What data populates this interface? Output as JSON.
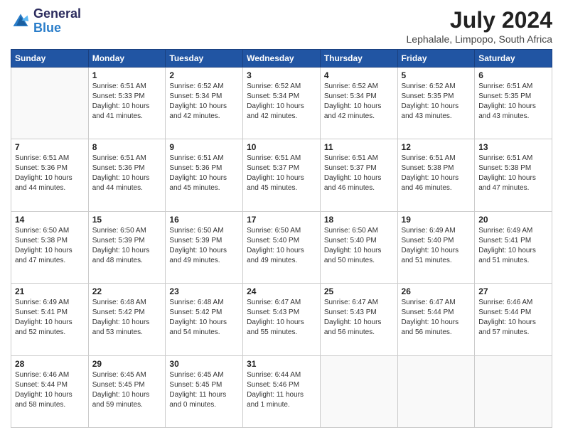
{
  "logo": {
    "line1": "General",
    "line2": "Blue"
  },
  "title": "July 2024",
  "location": "Lephalale, Limpopo, South Africa",
  "days_of_week": [
    "Sunday",
    "Monday",
    "Tuesday",
    "Wednesday",
    "Thursday",
    "Friday",
    "Saturday"
  ],
  "weeks": [
    [
      {
        "day": "",
        "info": ""
      },
      {
        "day": "1",
        "info": "Sunrise: 6:51 AM\nSunset: 5:33 PM\nDaylight: 10 hours\nand 41 minutes."
      },
      {
        "day": "2",
        "info": "Sunrise: 6:52 AM\nSunset: 5:34 PM\nDaylight: 10 hours\nand 42 minutes."
      },
      {
        "day": "3",
        "info": "Sunrise: 6:52 AM\nSunset: 5:34 PM\nDaylight: 10 hours\nand 42 minutes."
      },
      {
        "day": "4",
        "info": "Sunrise: 6:52 AM\nSunset: 5:34 PM\nDaylight: 10 hours\nand 42 minutes."
      },
      {
        "day": "5",
        "info": "Sunrise: 6:52 AM\nSunset: 5:35 PM\nDaylight: 10 hours\nand 43 minutes."
      },
      {
        "day": "6",
        "info": "Sunrise: 6:51 AM\nSunset: 5:35 PM\nDaylight: 10 hours\nand 43 minutes."
      }
    ],
    [
      {
        "day": "7",
        "info": "Sunrise: 6:51 AM\nSunset: 5:36 PM\nDaylight: 10 hours\nand 44 minutes."
      },
      {
        "day": "8",
        "info": "Sunrise: 6:51 AM\nSunset: 5:36 PM\nDaylight: 10 hours\nand 44 minutes."
      },
      {
        "day": "9",
        "info": "Sunrise: 6:51 AM\nSunset: 5:36 PM\nDaylight: 10 hours\nand 45 minutes."
      },
      {
        "day": "10",
        "info": "Sunrise: 6:51 AM\nSunset: 5:37 PM\nDaylight: 10 hours\nand 45 minutes."
      },
      {
        "day": "11",
        "info": "Sunrise: 6:51 AM\nSunset: 5:37 PM\nDaylight: 10 hours\nand 46 minutes."
      },
      {
        "day": "12",
        "info": "Sunrise: 6:51 AM\nSunset: 5:38 PM\nDaylight: 10 hours\nand 46 minutes."
      },
      {
        "day": "13",
        "info": "Sunrise: 6:51 AM\nSunset: 5:38 PM\nDaylight: 10 hours\nand 47 minutes."
      }
    ],
    [
      {
        "day": "14",
        "info": "Sunrise: 6:50 AM\nSunset: 5:38 PM\nDaylight: 10 hours\nand 47 minutes."
      },
      {
        "day": "15",
        "info": "Sunrise: 6:50 AM\nSunset: 5:39 PM\nDaylight: 10 hours\nand 48 minutes."
      },
      {
        "day": "16",
        "info": "Sunrise: 6:50 AM\nSunset: 5:39 PM\nDaylight: 10 hours\nand 49 minutes."
      },
      {
        "day": "17",
        "info": "Sunrise: 6:50 AM\nSunset: 5:40 PM\nDaylight: 10 hours\nand 49 minutes."
      },
      {
        "day": "18",
        "info": "Sunrise: 6:50 AM\nSunset: 5:40 PM\nDaylight: 10 hours\nand 50 minutes."
      },
      {
        "day": "19",
        "info": "Sunrise: 6:49 AM\nSunset: 5:40 PM\nDaylight: 10 hours\nand 51 minutes."
      },
      {
        "day": "20",
        "info": "Sunrise: 6:49 AM\nSunset: 5:41 PM\nDaylight: 10 hours\nand 51 minutes."
      }
    ],
    [
      {
        "day": "21",
        "info": "Sunrise: 6:49 AM\nSunset: 5:41 PM\nDaylight: 10 hours\nand 52 minutes."
      },
      {
        "day": "22",
        "info": "Sunrise: 6:48 AM\nSunset: 5:42 PM\nDaylight: 10 hours\nand 53 minutes."
      },
      {
        "day": "23",
        "info": "Sunrise: 6:48 AM\nSunset: 5:42 PM\nDaylight: 10 hours\nand 54 minutes."
      },
      {
        "day": "24",
        "info": "Sunrise: 6:47 AM\nSunset: 5:43 PM\nDaylight: 10 hours\nand 55 minutes."
      },
      {
        "day": "25",
        "info": "Sunrise: 6:47 AM\nSunset: 5:43 PM\nDaylight: 10 hours\nand 56 minutes."
      },
      {
        "day": "26",
        "info": "Sunrise: 6:47 AM\nSunset: 5:44 PM\nDaylight: 10 hours\nand 56 minutes."
      },
      {
        "day": "27",
        "info": "Sunrise: 6:46 AM\nSunset: 5:44 PM\nDaylight: 10 hours\nand 57 minutes."
      }
    ],
    [
      {
        "day": "28",
        "info": "Sunrise: 6:46 AM\nSunset: 5:44 PM\nDaylight: 10 hours\nand 58 minutes."
      },
      {
        "day": "29",
        "info": "Sunrise: 6:45 AM\nSunset: 5:45 PM\nDaylight: 10 hours\nand 59 minutes."
      },
      {
        "day": "30",
        "info": "Sunrise: 6:45 AM\nSunset: 5:45 PM\nDaylight: 11 hours\nand 0 minutes."
      },
      {
        "day": "31",
        "info": "Sunrise: 6:44 AM\nSunset: 5:46 PM\nDaylight: 11 hours\nand 1 minute."
      },
      {
        "day": "",
        "info": ""
      },
      {
        "day": "",
        "info": ""
      },
      {
        "day": "",
        "info": ""
      }
    ]
  ]
}
